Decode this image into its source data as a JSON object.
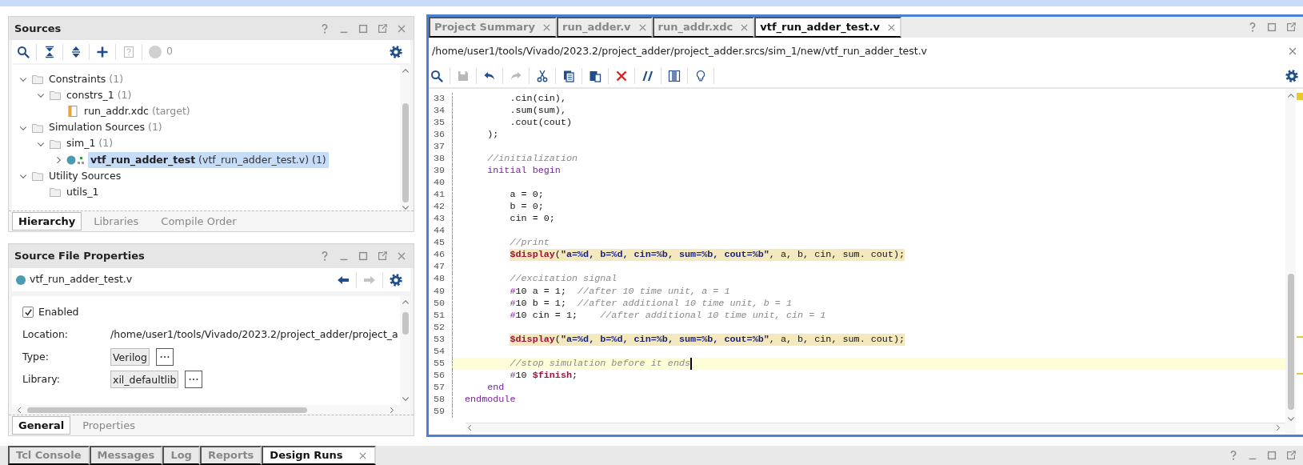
{
  "sources": {
    "title": "Sources",
    "toolbar": [
      {
        "kind": "search",
        "disabled": false
      },
      {
        "kind": "collapse",
        "disabled": false
      },
      {
        "kind": "expand",
        "disabled": false
      },
      {
        "kind": "plus",
        "disabled": false
      },
      {
        "kind": "helpbox",
        "disabled": true
      }
    ],
    "status_count": "0",
    "tree": [
      {
        "kind": "folder",
        "label": "Constraints",
        "note": "(1)",
        "expanded": true,
        "selected": false,
        "children": [
          {
            "kind": "folder",
            "label": "constrs_1",
            "note": "(1)",
            "expanded": true,
            "selected": false,
            "children": [
              {
                "kind": "xdc",
                "label": "run_addr.xdc",
                "note": "(target)",
                "selected": false
              }
            ]
          }
        ]
      },
      {
        "kind": "folder",
        "label": "Simulation Sources",
        "note": "(1)",
        "expanded": true,
        "selected": false,
        "children": [
          {
            "kind": "folder",
            "label": "sim_1",
            "note": "(1)",
            "expanded": true,
            "selected": false,
            "children": [
              {
                "kind": "module",
                "label": "vtf_run_adder_test",
                "note": "(vtf_run_adder_test.v) (1)",
                "expanded": false,
                "selected": true
              }
            ]
          }
        ]
      },
      {
        "kind": "folder",
        "label": "Utility Sources",
        "expanded": true,
        "selected": false,
        "children": [
          {
            "kind": "folder",
            "label": "utils_1",
            "selected": false
          }
        ]
      }
    ],
    "tabs": [
      {
        "label": "Hierarchy",
        "selected": true
      },
      {
        "label": "Libraries",
        "selected": false
      },
      {
        "label": "Compile Order",
        "selected": false
      }
    ]
  },
  "properties": {
    "title": "Source File Properties",
    "file": "vtf_run_adder_test.v",
    "nav": [
      {
        "kind": "back",
        "disabled": false
      },
      {
        "kind": "forward",
        "disabled": true
      }
    ],
    "enabled": {
      "label": "Enabled",
      "checked": true
    },
    "fields": [
      {
        "kind": "text",
        "label": "Location:",
        "value": "/home/user1/tools/Vivado/2023.2/project_adder/project_a"
      },
      {
        "kind": "choice",
        "label": "Type:",
        "value": "Verilog"
      },
      {
        "kind": "choice",
        "label": "Library:",
        "value": "xil_defaultlib"
      }
    ],
    "tabs": [
      {
        "label": "General",
        "selected": true
      },
      {
        "label": "Properties",
        "selected": false
      }
    ]
  },
  "editor": {
    "tabs": [
      {
        "label": "Project Summary",
        "selected": false
      },
      {
        "label": "run_adder.v",
        "selected": false
      },
      {
        "label": "run_addr.xdc",
        "selected": false
      },
      {
        "label": "vtf_run_adder_test.v",
        "selected": true
      }
    ],
    "path": "/home/user1/tools/Vivado/2023.2/project_adder/project_adder.srcs/sim_1/new/vtf_run_adder_test.v",
    "toolbar": [
      {
        "kind": "search",
        "disabled": false
      },
      {
        "kind": "save",
        "disabled": true
      },
      {
        "kind": "undo",
        "disabled": false
      },
      {
        "kind": "redo",
        "disabled": true
      },
      {
        "kind": "cut",
        "disabled": false
      },
      {
        "kind": "copy",
        "disabled": false
      },
      {
        "kind": "paste",
        "disabled": false
      },
      {
        "kind": "delete",
        "disabled": false
      },
      {
        "kind": "comment",
        "disabled": false
      },
      {
        "kind": "columns",
        "disabled": false
      },
      {
        "kind": "bulb",
        "disabled": false
      }
    ],
    "lines": [
      {
        "number": "33",
        "tokens": [
          {
            "kind": "plain",
            "text": "        .cin(cin),"
          }
        ]
      },
      {
        "number": "34",
        "tokens": [
          {
            "kind": "plain",
            "text": "        .sum(sum),"
          }
        ]
      },
      {
        "number": "35",
        "tokens": [
          {
            "kind": "plain",
            "text": "        .cout(cout)"
          }
        ]
      },
      {
        "number": "36",
        "tokens": [
          {
            "kind": "plain",
            "text": "    );"
          }
        ]
      },
      {
        "number": "37"
      },
      {
        "number": "38",
        "tokens": [
          {
            "kind": "comment",
            "text": "    //initialization"
          }
        ]
      },
      {
        "number": "39",
        "tokens": [
          {
            "kind": "keyword",
            "text": "    initial begin"
          }
        ]
      },
      {
        "number": "40"
      },
      {
        "number": "41",
        "tokens": [
          {
            "kind": "plain",
            "text": "        a = 0;"
          }
        ]
      },
      {
        "number": "42",
        "tokens": [
          {
            "kind": "plain",
            "text": "        b = 0;"
          }
        ]
      },
      {
        "number": "43",
        "tokens": [
          {
            "kind": "plain",
            "text": "        cin = 0;"
          }
        ]
      },
      {
        "number": "44"
      },
      {
        "number": "45",
        "tokens": [
          {
            "kind": "comment",
            "text": "        //print"
          }
        ]
      },
      {
        "number": "46",
        "highlighted": true,
        "tokens": [
          {
            "kind": "system",
            "text": "        $display"
          },
          {
            "kind": "plain",
            "text": "("
          },
          {
            "kind": "string",
            "text": "\"a=%d, b=%d, cin=%b, sum=%b, cout=%b\""
          },
          {
            "kind": "plain",
            "text": ", a, b, cin, sum. cout);"
          }
        ]
      },
      {
        "number": "47"
      },
      {
        "number": "48",
        "tokens": [
          {
            "kind": "comment",
            "text": "        //excitation signal"
          }
        ]
      },
      {
        "number": "49",
        "tokens": [
          {
            "kind": "keyword",
            "text": "        #"
          },
          {
            "kind": "plain",
            "text": "10 a = 1;  "
          },
          {
            "kind": "comment",
            "text": "//after 10 time unit, a = 1"
          }
        ]
      },
      {
        "number": "50",
        "tokens": [
          {
            "kind": "keyword",
            "text": "        #"
          },
          {
            "kind": "plain",
            "text": "10 b = 1;  "
          },
          {
            "kind": "comment",
            "text": "//after additional 10 time unit, b = 1"
          }
        ]
      },
      {
        "number": "51",
        "tokens": [
          {
            "kind": "keyword",
            "text": "        #"
          },
          {
            "kind": "plain",
            "text": "10 cin = 1;    "
          },
          {
            "kind": "comment",
            "text": "//after additional 10 time unit, cin = 1"
          }
        ]
      },
      {
        "number": "52"
      },
      {
        "number": "53",
        "highlighted": true,
        "tokens": [
          {
            "kind": "system",
            "text": "        $display"
          },
          {
            "kind": "plain",
            "text": "("
          },
          {
            "kind": "string",
            "text": "\"a=%d, b=%d, cin=%b, sum=%b, cout=%b\""
          },
          {
            "kind": "plain",
            "text": ", a, b, cin, sum. cout);"
          }
        ]
      },
      {
        "number": "54"
      },
      {
        "number": "55",
        "current_line": true,
        "cursor": true,
        "tokens": [
          {
            "kind": "comment",
            "text": "        //stop simulation before it ends"
          }
        ]
      },
      {
        "number": "56",
        "tokens": [
          {
            "kind": "keyword",
            "text": "        #"
          },
          {
            "kind": "plain",
            "text": "10 "
          },
          {
            "kind": "system",
            "text": "$finish"
          },
          {
            "kind": "plain",
            "text": ";"
          }
        ]
      },
      {
        "number": "57",
        "tokens": [
          {
            "kind": "keyword",
            "text": "    end"
          }
        ]
      },
      {
        "number": "58",
        "tokens": [
          {
            "kind": "keyword",
            "text": "endmodule"
          }
        ]
      },
      {
        "number": "59"
      }
    ]
  },
  "bottom_tabs": [
    {
      "label": "Tcl Console",
      "selected": false
    },
    {
      "label": "Messages",
      "selected": false
    },
    {
      "label": "Log",
      "selected": false
    },
    {
      "label": "Reports",
      "selected": false
    },
    {
      "label": "Design Runs",
      "selected": true
    }
  ]
}
